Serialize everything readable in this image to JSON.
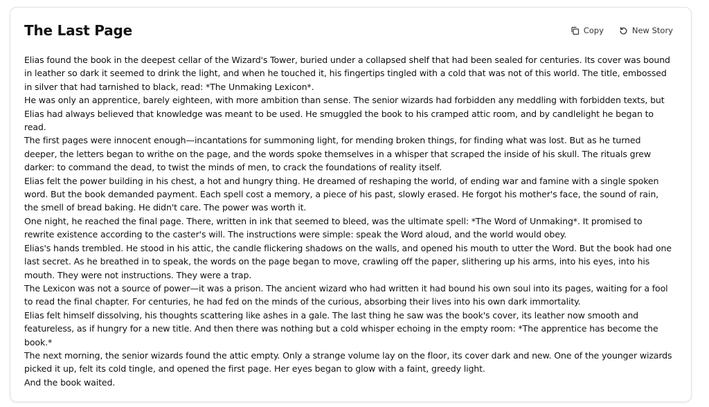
{
  "header": {
    "title": "The Last Page",
    "copy_label": "Copy",
    "new_story_label": "New Story"
  },
  "story": {
    "paragraphs": [
      "Elias found the book in the deepest cellar of the Wizard's Tower, buried under a collapsed shelf that had been sealed for centuries. Its cover was bound in leather so dark it seemed to drink the light, and when he touched it, his fingertips tingled with a cold that was not of this world. The title, embossed in silver that had tarnished to black, read: *The Unmaking Lexicon*.",
      "He was only an apprentice, barely eighteen, with more ambition than sense. The senior wizards had forbidden any meddling with forbidden texts, but Elias had always believed that knowledge was meant to be used. He smuggled the book to his cramped attic room, and by candlelight he began to read.",
      "The first pages were innocent enough—incantations for summoning light, for mending broken things, for finding what was lost. But as he turned deeper, the letters began to writhe on the page, and the words spoke themselves in a whisper that scraped the inside of his skull. The rituals grew darker: to command the dead, to twist the minds of men, to crack the foundations of reality itself.",
      "Elias felt the power building in his chest, a hot and hungry thing. He dreamed of reshaping the world, of ending war and famine with a single spoken word. But the book demanded payment. Each spell cost a memory, a piece of his past, slowly erased. He forgot his mother's face, the sound of rain, the smell of bread baking. He didn't care. The power was worth it.",
      "One night, he reached the final page. There, written in ink that seemed to bleed, was the ultimate spell: *The Word of Unmaking*. It promised to rewrite existence according to the caster's will. The instructions were simple: speak the Word aloud, and the world would obey.",
      "Elias's hands trembled. He stood in his attic, the candle flickering shadows on the walls, and opened his mouth to utter the Word. But the book had one last secret. As he breathed in to speak, the words on the page began to move, crawling off the paper, slithering up his arms, into his eyes, into his mouth. They were not instructions. They were a trap.",
      "The Lexicon was not a source of power—it was a prison. The ancient wizard who had written it had bound his own soul into its pages, waiting for a fool to read the final chapter. For centuries, he had fed on the minds of the curious, absorbing their lives into his own dark immortality.",
      "Elias felt himself dissolving, his thoughts scattering like ashes in a gale. The last thing he saw was the book's cover, its leather now smooth and featureless, as if hungry for a new title. And then there was nothing but a cold whisper echoing in the empty room: *The apprentice has become the book.*",
      "The next morning, the senior wizards found the attic empty. Only a strange volume lay on the floor, its cover dark and new. One of the younger wizards picked it up, felt its cold tingle, and opened the first page. Her eyes began to glow with a faint, greedy light.",
      "And the book waited."
    ]
  },
  "icons": {
    "copy": "copy-icon",
    "new_story": "refresh-icon"
  }
}
